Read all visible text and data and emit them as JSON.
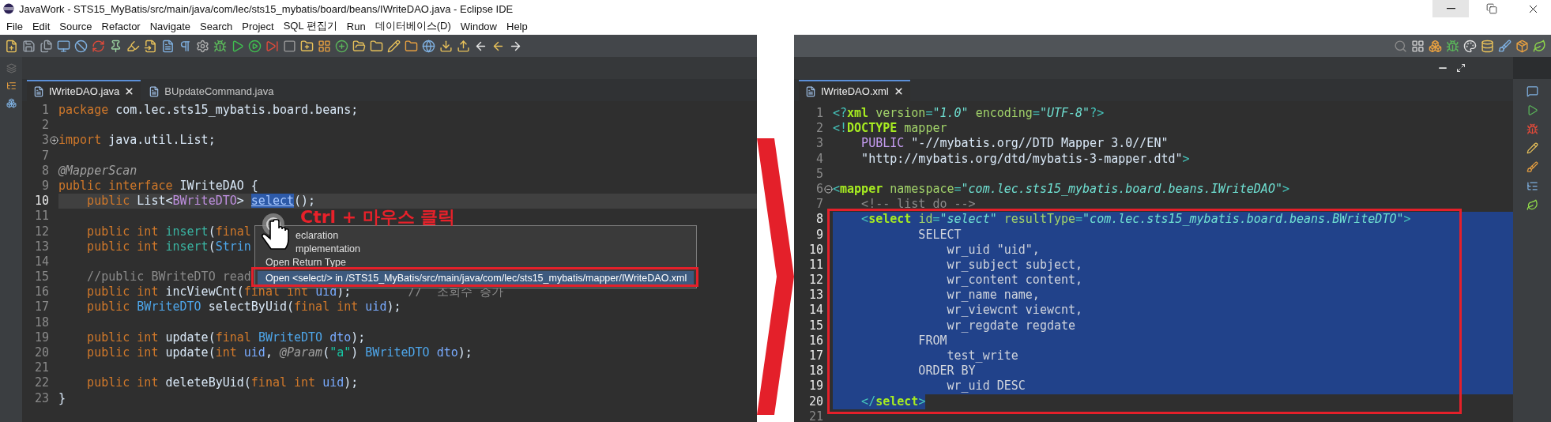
{
  "window": {
    "title": "JavaWork - STS15_MyBatis/src/main/java/com/lec/sts15_mybatis/board/beans/IWriteDAO.java - Eclipse IDE"
  },
  "menu": [
    "File",
    "Edit",
    "Source",
    "Refactor",
    "Navigate",
    "Search",
    "Project",
    "SQL 편집기",
    "Run",
    "데이터베이스(D)",
    "Window",
    "Help"
  ],
  "left_editor": {
    "tabs": [
      {
        "label": "IWriteDAO.java",
        "selected": true,
        "closable": true
      },
      {
        "label": "BUpdateCommand.java",
        "selected": false,
        "closable": false
      }
    ],
    "lines": [
      {
        "number": "1",
        "current": false,
        "tokens": [
          {
            "kind": "keyword",
            "text": "package "
          },
          {
            "kind": "plain",
            "text": "com.lec.sts15_mybatis.board.beans;"
          }
        ]
      },
      {
        "number": "2",
        "current": false
      },
      {
        "number": "3",
        "current": false,
        "collapsed": true,
        "tokens": [
          {
            "kind": "keyword",
            "text": "import "
          },
          {
            "kind": "plain",
            "text": "java.util.List;"
          }
        ]
      },
      {
        "number": "7",
        "current": false
      },
      {
        "number": "8",
        "current": false,
        "tokens": [
          {
            "kind": "annotation",
            "text": "@MapperScan"
          }
        ]
      },
      {
        "number": "9",
        "current": false,
        "tokens": [
          {
            "kind": "keyword",
            "text": "public interface "
          },
          {
            "kind": "plain",
            "text": "IWriteDAO {"
          }
        ]
      },
      {
        "number": "10",
        "current": true,
        "tokens": [
          {
            "kind": "keyword",
            "text": "    public "
          },
          {
            "kind": "plain",
            "text": "List<"
          },
          {
            "kind": "type_param",
            "text": "BWriteDTO"
          },
          {
            "kind": "plain",
            "text": "> "
          },
          {
            "kind": "link",
            "text": "select"
          },
          {
            "kind": "plain",
            "text": "();"
          }
        ]
      },
      {
        "number": "11",
        "current": false
      },
      {
        "number": "12",
        "current": false,
        "tokens": [
          {
            "kind": "keyword",
            "text": "    public int "
          },
          {
            "kind": "method",
            "text": "insert"
          },
          {
            "kind": "plain",
            "text": "("
          },
          {
            "kind": "keyword",
            "text": "final"
          }
        ]
      },
      {
        "number": "13",
        "current": false,
        "tokens": [
          {
            "kind": "keyword",
            "text": "    public int "
          },
          {
            "kind": "method",
            "text": "insert"
          },
          {
            "kind": "plain",
            "text": "("
          },
          {
            "kind": "type",
            "text": "Strin"
          }
        ]
      },
      {
        "number": "14",
        "current": false
      },
      {
        "number": "15",
        "current": false,
        "tokens": [
          {
            "kind": "comment",
            "text": "    //public BWriteDTO read"
          }
        ]
      },
      {
        "number": "16",
        "current": false,
        "tokens": [
          {
            "kind": "keyword",
            "text": "    public int "
          },
          {
            "kind": "plain",
            "text": "incViewCnt("
          },
          {
            "kind": "keyword",
            "text": "final int "
          },
          {
            "kind": "param",
            "text": "uid"
          },
          {
            "kind": "plain",
            "text": ");"
          },
          {
            "kind": "comment",
            "text": "        //  조회수 증가"
          }
        ]
      },
      {
        "number": "17",
        "current": false,
        "tokens": [
          {
            "kind": "keyword",
            "text": "    public "
          },
          {
            "kind": "type",
            "text": "BWriteDTO "
          },
          {
            "kind": "plain",
            "text": "selectByUid("
          },
          {
            "kind": "keyword",
            "text": "final int "
          },
          {
            "kind": "param",
            "text": "uid"
          },
          {
            "kind": "plain",
            "text": ");"
          }
        ]
      },
      {
        "number": "18",
        "current": false
      },
      {
        "number": "19",
        "current": false,
        "tokens": [
          {
            "kind": "keyword",
            "text": "    public int "
          },
          {
            "kind": "plain",
            "text": "update("
          },
          {
            "kind": "keyword",
            "text": "final "
          },
          {
            "kind": "type",
            "text": "BWriteDTO "
          },
          {
            "kind": "param",
            "text": "dto"
          },
          {
            "kind": "plain",
            "text": ");"
          }
        ]
      },
      {
        "number": "20",
        "current": false,
        "tokens": [
          {
            "kind": "keyword",
            "text": "    public int "
          },
          {
            "kind": "plain",
            "text": "update("
          },
          {
            "kind": "keyword",
            "text": "int "
          },
          {
            "kind": "param",
            "text": "uid"
          },
          {
            "kind": "plain",
            "text": ", "
          },
          {
            "kind": "annotation",
            "text": "@Param"
          },
          {
            "kind": "plain",
            "text": "("
          },
          {
            "kind": "string",
            "text": "\"a\""
          },
          {
            "kind": "plain",
            "text": ") "
          },
          {
            "kind": "type",
            "text": "BWriteDTO "
          },
          {
            "kind": "param",
            "text": "dto"
          },
          {
            "kind": "plain",
            "text": ");"
          }
        ]
      },
      {
        "number": "21",
        "current": false
      },
      {
        "number": "22",
        "current": false,
        "tokens": [
          {
            "kind": "keyword",
            "text": "    public int "
          },
          {
            "kind": "plain",
            "text": "deleteByUid("
          },
          {
            "kind": "keyword",
            "text": "final int "
          },
          {
            "kind": "param",
            "text": "uid"
          },
          {
            "kind": "plain",
            "text": ");"
          }
        ]
      },
      {
        "number": "23",
        "current": false,
        "tokens": [
          {
            "kind": "plain",
            "text": "}"
          }
        ]
      }
    ]
  },
  "popup": {
    "items": [
      {
        "label": "eclaration",
        "covered": true,
        "selected": false
      },
      {
        "label": "mplementation",
        "covered": true,
        "selected": false
      },
      {
        "label": "Open Return Type",
        "covered": false,
        "selected": false
      },
      {
        "label": "Open <select/> in /STS15_MyBatis/src/main/java/com/lec/sts15_mybatis/mapper/IWriteDAO.xml",
        "covered": false,
        "selected": true
      }
    ]
  },
  "annotation": {
    "text": "Ctrl + 마우스 클릭"
  },
  "right_editor": {
    "tabs": [
      {
        "label": "IWriteDAO.xml",
        "selected": true,
        "closable": true
      }
    ],
    "lines": [
      {
        "number": "1",
        "selected": false,
        "tokens": [
          {
            "kind": "bracket",
            "text": "<?"
          },
          {
            "kind": "tag",
            "text": "xml "
          },
          {
            "kind": "attr",
            "text": "version"
          },
          {
            "kind": "bracket",
            "text": "="
          },
          {
            "kind": "value",
            "text": "\"1.0\" "
          },
          {
            "kind": "attr",
            "text": "encoding"
          },
          {
            "kind": "bracket",
            "text": "="
          },
          {
            "kind": "value",
            "text": "\"UTF-8\""
          },
          {
            "kind": "bracket",
            "text": "?>"
          }
        ]
      },
      {
        "number": "2",
        "selected": false,
        "tokens": [
          {
            "kind": "bracket",
            "text": "<!"
          },
          {
            "kind": "tag",
            "text": "DOCTYPE "
          },
          {
            "kind": "attr",
            "text": "mapper"
          }
        ]
      },
      {
        "number": "3",
        "selected": false,
        "tokens": [
          {
            "kind": "doctype_keyword",
            "text": "    PUBLIC "
          },
          {
            "kind": "plain",
            "text": "\"-//mybatis.org//DTD Mapper 3.0//EN\""
          }
        ]
      },
      {
        "number": "4",
        "selected": false,
        "tokens": [
          {
            "kind": "plain",
            "text": "    \"http://mybatis.org/dtd/mybatis-3-mapper.dtd\""
          },
          {
            "kind": "bracket",
            "text": ">"
          }
        ]
      },
      {
        "number": "5",
        "selected": false
      },
      {
        "number": "6",
        "selected": false,
        "collapsed": false,
        "tokens": [
          {
            "kind": "bracket",
            "text": "<"
          },
          {
            "kind": "tag",
            "text": "mapper "
          },
          {
            "kind": "attr",
            "text": "namespace"
          },
          {
            "kind": "bracket",
            "text": "="
          },
          {
            "kind": "value",
            "text": "\"com.lec.sts15_mybatis.board.beans.IWriteDAO\""
          },
          {
            "kind": "bracket",
            "text": ">"
          }
        ]
      },
      {
        "number": "7",
        "selected": false,
        "tokens": [
          {
            "kind": "comment",
            "text": "    <!-- list do -->"
          }
        ]
      },
      {
        "number": "8",
        "selected": true,
        "tokens": [
          {
            "kind": "bracket",
            "text": "    <"
          },
          {
            "kind": "tag",
            "text": "select "
          },
          {
            "kind": "attr",
            "text": "id"
          },
          {
            "kind": "bracket",
            "text": "="
          },
          {
            "kind": "value",
            "text": "\"select\" "
          },
          {
            "kind": "attr",
            "text": "resultType"
          },
          {
            "kind": "bracket",
            "text": "="
          },
          {
            "kind": "value",
            "text": "\"com.lec.sts15_mybatis.board.beans.BWriteDTO\""
          },
          {
            "kind": "bracket",
            "text": ">"
          }
        ]
      },
      {
        "number": "9",
        "selected": true,
        "tokens": [
          {
            "kind": "sql",
            "text": "            SELECT"
          }
        ]
      },
      {
        "number": "10",
        "selected": true,
        "tokens": [
          {
            "kind": "sql",
            "text": "                wr_uid \"uid\","
          }
        ]
      },
      {
        "number": "11",
        "selected": true,
        "tokens": [
          {
            "kind": "sql",
            "text": "                wr_subject subject,"
          }
        ]
      },
      {
        "number": "12",
        "selected": true,
        "tokens": [
          {
            "kind": "sql",
            "text": "                wr_content content,"
          }
        ]
      },
      {
        "number": "13",
        "selected": true,
        "tokens": [
          {
            "kind": "sql",
            "text": "                wr_name name,"
          }
        ]
      },
      {
        "number": "14",
        "selected": true,
        "tokens": [
          {
            "kind": "sql",
            "text": "                wr_viewcnt viewcnt,"
          }
        ]
      },
      {
        "number": "15",
        "selected": true,
        "tokens": [
          {
            "kind": "sql",
            "text": "                wr_regdate regdate"
          }
        ]
      },
      {
        "number": "16",
        "selected": true,
        "tokens": [
          {
            "kind": "sql",
            "text": "            FROM"
          }
        ]
      },
      {
        "number": "17",
        "selected": true,
        "tokens": [
          {
            "kind": "sql",
            "text": "                test_write"
          }
        ]
      },
      {
        "number": "18",
        "selected": true,
        "tokens": [
          {
            "kind": "sql",
            "text": "            ORDER BY"
          }
        ]
      },
      {
        "number": "19",
        "selected": true,
        "tokens": [
          {
            "kind": "sql",
            "text": "                wr_uid DESC"
          }
        ]
      },
      {
        "number": "20",
        "selected": true,
        "tokens": [
          {
            "kind": "bracket",
            "text": "    </"
          },
          {
            "kind": "tag",
            "text": "select"
          },
          {
            "kind": "bracket",
            "text": ">"
          }
        ]
      },
      {
        "number": "21",
        "selected": false
      }
    ]
  }
}
